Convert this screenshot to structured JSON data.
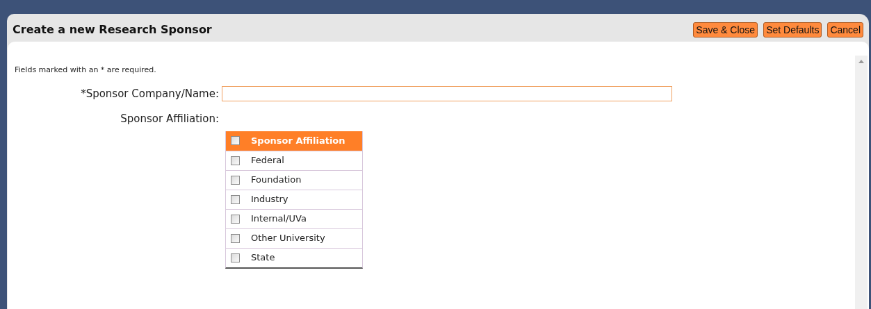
{
  "dialog": {
    "title": "Create a new Research Sponsor",
    "buttons": [
      "Save & Close",
      "Set Defaults",
      "Cancel"
    ]
  },
  "note": "Fields marked with an * are required.",
  "fields": [
    {
      "label": "*Sponsor Company/Name:"
    }
  ],
  "affiliation": {
    "label": "Sponsor Affiliation:",
    "header": {
      "label": "Sponsor Affiliation",
      "checked": false
    },
    "options": [
      {
        "label": "Federal",
        "checked": false
      },
      {
        "label": "Foundation",
        "checked": false
      },
      {
        "label": "Industry",
        "checked": false
      },
      {
        "label": "Internal/UVa",
        "checked": false
      },
      {
        "label": "Other University",
        "checked": false
      },
      {
        "label": "State",
        "checked": false
      }
    ]
  }
}
